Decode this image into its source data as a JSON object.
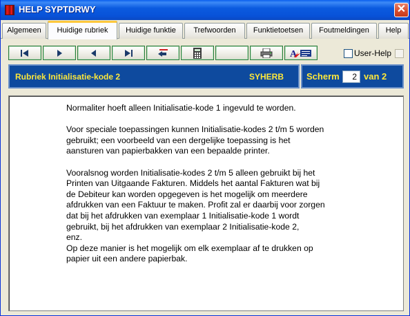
{
  "window": {
    "title": "HELP SYPTDRWY",
    "close_glyph": "✕"
  },
  "tabs": [
    {
      "label": "Algemeen",
      "active": false
    },
    {
      "label": "Huidige rubriek",
      "active": true
    },
    {
      "label": "Huidige funktie",
      "active": false
    },
    {
      "label": "Trefwoorden",
      "active": false
    },
    {
      "label": "Funktietoetsen",
      "active": false
    },
    {
      "label": "Foutmeldingen",
      "active": false
    },
    {
      "label": "Help",
      "active": false
    }
  ],
  "toolbar": {
    "buttons": [
      {
        "name": "first-page-button",
        "icon": "first-icon"
      },
      {
        "name": "next-page-button",
        "icon": "play-right-icon"
      },
      {
        "name": "previous-page-button",
        "icon": "play-left-icon"
      },
      {
        "name": "last-page-button",
        "icon": "last-icon"
      },
      {
        "name": "back-button",
        "icon": "back-arrow-icon"
      },
      {
        "name": "calculator-button",
        "icon": "calculator-icon"
      },
      {
        "name": "blank-button",
        "icon": "none"
      },
      {
        "name": "print-button",
        "icon": "printer-icon"
      },
      {
        "name": "spellcheck-button",
        "icon": "spellcheck-icon"
      }
    ],
    "user_help_label": "User-Help",
    "user_help_checked": false
  },
  "rubriek": {
    "title": "Rubriek Initialisatie-kode 2",
    "code": "SYHERB"
  },
  "scherm": {
    "label": "Scherm",
    "current": "2",
    "van_label": "van 2"
  },
  "content": {
    "text": "Normaliter hoeft alleen Initialisatie-kode 1 ingevuld te worden.\n\nVoor speciale toepassingen kunnen Initialisatie-kodes 2 t/m 5 worden\ngebruikt; een voorbeeld van een dergelijke toepassing is het\naansturen van papierbakken van een bepaalde printer.\n\nVooralsnog worden Initialisatie-kodes 2 t/m 5 alleen gebruikt bij het\nPrinten van Uitgaande Fakturen. Middels het aantal Fakturen wat bij\nde Debiteur kan worden opgegeven is het mogelijk om meerdere\nafdrukken van een Faktuur te maken. Profit zal er daarbij voor zorgen\ndat bij het afdrukken van exemplaar 1 Initialisatie-kode 1 wordt\ngebruikt, bij het afdrukken van exemplaar 2 Initialisatie-kode 2,\nenz.\nOp deze manier is het mogelijk om elk exemplaar af te drukken op\npapier uit een andere papierbak."
  },
  "colors": {
    "title_bar": "#0852D8",
    "header_bar": "#0E4A9E",
    "header_text": "#FFE83A",
    "active_tab_accent": "#FFC83C",
    "toolbar_border": "#2C7A3C"
  }
}
